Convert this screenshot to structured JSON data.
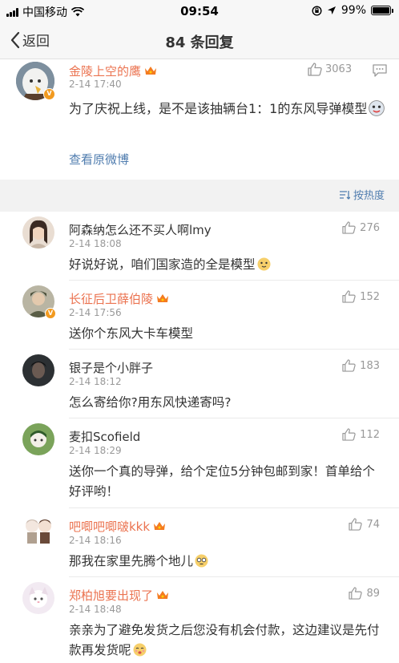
{
  "status_bar": {
    "carrier": "中国移动",
    "time": "09:54",
    "battery": "99%",
    "battery_level": 0.99
  },
  "nav": {
    "back_label": "返回",
    "title": "84 条回复"
  },
  "post": {
    "author": "金陵上空的鹰",
    "time": "2-14 17:40",
    "likes": "3063",
    "content": "为了庆祝上线，是不是该抽辆台1：1的东风导弹模型",
    "view_original": "查看原微博"
  },
  "sort": {
    "label": "按热度"
  },
  "comments": [
    {
      "author": "阿森纳怎么还不买人啊lmy",
      "time": "2-14 18:08",
      "likes": "276",
      "text": "好说好说，咱们国家造的全是模型"
    },
    {
      "author": "长征后卫薛伯陵",
      "time": "2-14 17:56",
      "likes": "152",
      "text": "送你个东风大卡车模型"
    },
    {
      "author": "银子是个小胖子",
      "time": "2-14 18:12",
      "likes": "183",
      "text": "怎么寄给你?用东风快递寄吗?"
    },
    {
      "author": "麦扣Scofield",
      "time": "2-14 18:29",
      "likes": "112",
      "text": "送你一个真的导弹，给个定位5分钟包邮到家！首单给个好评哟！"
    },
    {
      "author": "吧唧吧唧啵kkk",
      "time": "2-14 18:16",
      "likes": "74",
      "text": "那我在家里先腾个地儿"
    },
    {
      "author": "郑柏旭要出现了",
      "time": "2-14 18:48",
      "likes": "89",
      "text": "亲亲为了避免发货之后您没有机会付款，这边建议是先付款再发货呢"
    }
  ]
}
